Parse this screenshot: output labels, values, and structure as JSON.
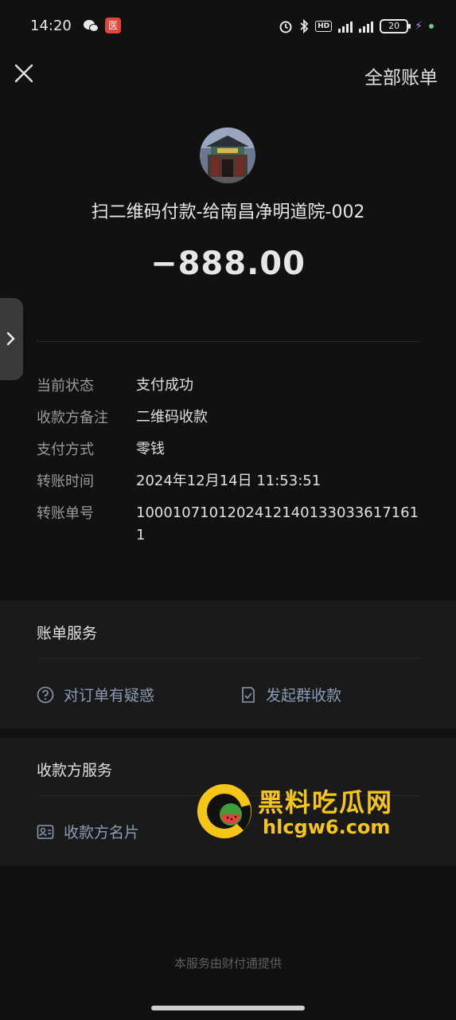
{
  "status_bar": {
    "time": "14:20",
    "app_icon_text": "医",
    "hd_label": "HD",
    "battery": "20",
    "icons": [
      "wechat-icon",
      "alarm-icon",
      "bluetooth-icon",
      "signal-icon",
      "battery-icon",
      "charging-icon"
    ]
  },
  "nav": {
    "close_icon": "close-icon",
    "all_bills": "全部账单"
  },
  "merchant": {
    "title": "扫二维码付款-给南昌净明道院-002",
    "amount": "−888.00"
  },
  "details": [
    {
      "label": "当前状态",
      "value": "支付成功"
    },
    {
      "label": "收款方备注",
      "value": "二维码收款"
    },
    {
      "label": "支付方式",
      "value": "零钱"
    },
    {
      "label": "转账时间",
      "value": "2024年12月14日 11:53:51"
    },
    {
      "label": "转账单号",
      "value": "1000107101202412140133033617161 1"
    }
  ],
  "bill_service": {
    "title": "账单服务",
    "doubt": "对订单有疑惑",
    "group_collect": "发起群收款"
  },
  "payee_service": {
    "title": "收款方服务",
    "card": "收款方名片"
  },
  "watermark": {
    "name": "黑料吃瓜网",
    "url": "hlcgw6.com"
  },
  "footer": "本服务由财付通提供",
  "colors": {
    "background": "#111111",
    "section_bg": "#1a1a1a",
    "link": "#8a9bb6",
    "watermark": "#f5c518"
  }
}
